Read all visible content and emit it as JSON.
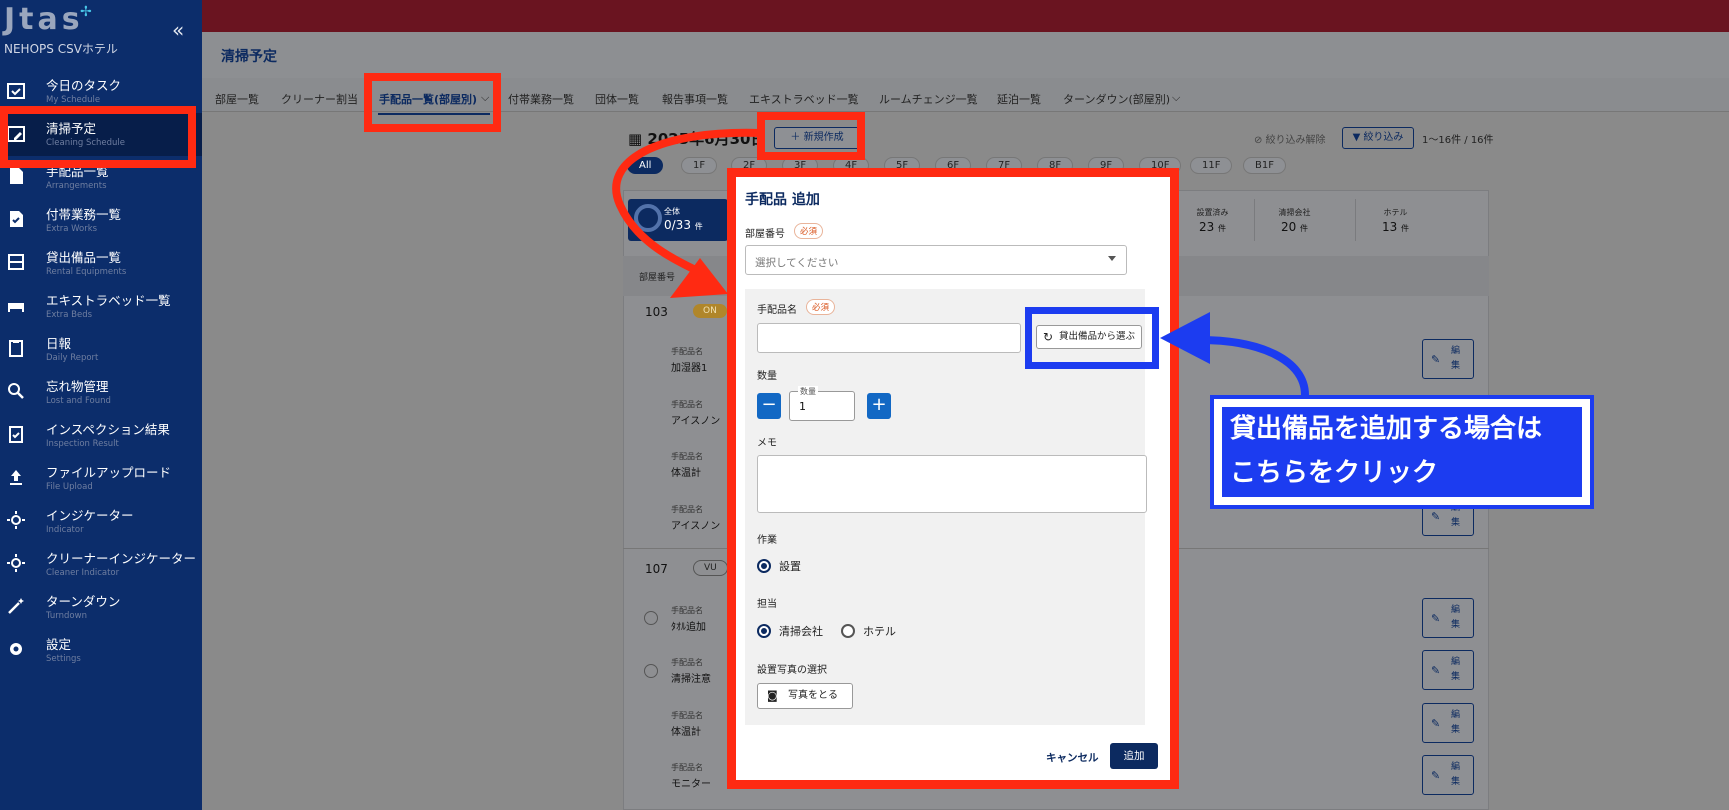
{
  "app": {
    "logo": "Jtas",
    "hotel": "NEHOPS CSVホテル"
  },
  "sidebar": {
    "items": [
      {
        "label": "今日のタスク",
        "sub": "My Schedule"
      },
      {
        "label": "清掃予定",
        "sub": "Cleaning Schedule"
      },
      {
        "label": "手配品一覧",
        "sub": "Arrangements"
      },
      {
        "label": "付帯業務一覧",
        "sub": "Extra Works"
      },
      {
        "label": "貸出備品一覧",
        "sub": "Rental Equipments"
      },
      {
        "label": "エキストラベッド一覧",
        "sub": "Extra Beds"
      },
      {
        "label": "日報",
        "sub": "Daily Report"
      },
      {
        "label": "忘れ物管理",
        "sub": "Lost and Found"
      },
      {
        "label": "インスペクション結果",
        "sub": "Inspection Result"
      },
      {
        "label": "ファイルアップロード",
        "sub": "File Upload"
      },
      {
        "label": "インジケーター",
        "sub": "Indicator"
      },
      {
        "label": "クリーナーインジケーター",
        "sub": "Cleaner Indicator"
      },
      {
        "label": "ターンダウン",
        "sub": "Turndown"
      },
      {
        "label": "設定",
        "sub": "Settings"
      }
    ]
  },
  "header": {
    "title": "清掃予定"
  },
  "tabs": [
    "部屋一覧",
    "クリーナー割当",
    "手配品一覧(部屋別)",
    "付帯業務一覧",
    "団体一覧",
    "報告事項一覧",
    "エキストラベッド一覧",
    "ルームチェンジ一覧",
    "延泊一覧",
    "ターンダウン(部屋別)"
  ],
  "toolbar": {
    "date": "2025年6月30日",
    "new_label": "新規作成",
    "filter_clear": "絞り込み解除",
    "filter": "絞り込み",
    "count": "1〜16件 / 16件"
  },
  "floors": [
    "All",
    "1F",
    "2F",
    "3F",
    "4F",
    "5F",
    "6F",
    "7F",
    "8F",
    "9F",
    "10F",
    "11F",
    "B1F"
  ],
  "stats": {
    "total_label": "全体",
    "total_value": "0/33",
    "total_unit": "件",
    "items": [
      {
        "label": "設置済み",
        "value": "23",
        "unit": "件"
      },
      {
        "label": "清掃会社",
        "value": "20",
        "unit": "件"
      },
      {
        "label": "ホテル",
        "value": "13",
        "unit": "件"
      }
    ]
  },
  "table": {
    "col_room": "部屋番号",
    "rooms": [
      {
        "number": "103",
        "badge": "ON",
        "items": [
          {
            "key": "手配品名",
            "value": "加湿器1"
          },
          {
            "key": "手配品名",
            "value": "アイスノン"
          },
          {
            "key": "手配品名",
            "value": "体温計"
          },
          {
            "key": "手配品名",
            "value": "アイスノン"
          }
        ]
      },
      {
        "number": "107",
        "badge": "VU",
        "items": [
          {
            "key": "手配品名",
            "value": "ﾀｵﾙ追加"
          },
          {
            "key": "手配品名",
            "value": "清掃注意"
          },
          {
            "key": "手配品名",
            "value": "体温計"
          },
          {
            "key": "手配品名",
            "value": "モニター"
          }
        ]
      }
    ],
    "edit_label": "編集"
  },
  "dialog": {
    "title": "手配品 追加",
    "room_label": "部屋番号",
    "required": "必須",
    "room_placeholder": "選択してください",
    "item_name_label": "手配品名",
    "rental_button": "貸出備品から選ぶ",
    "qty_label": "数量",
    "qty_caption": "数量",
    "qty_value": "1",
    "memo_label": "メモ",
    "work_label": "作業",
    "work_option": "設置",
    "owner_label": "担当",
    "owner_options": [
      "清掃会社",
      "ホテル"
    ],
    "photo_label": "設置写真の選択",
    "photo_button": "写真をとる",
    "cancel": "キャンセル",
    "add": "追加"
  },
  "annotation": {
    "line1": "貸出備品を追加する場合は",
    "line2": "こちらをクリック"
  },
  "colors": {
    "highlight_red": "#ff2a12",
    "highlight_blue": "#1c3cf0",
    "brand_navy": "#0c2a60"
  }
}
